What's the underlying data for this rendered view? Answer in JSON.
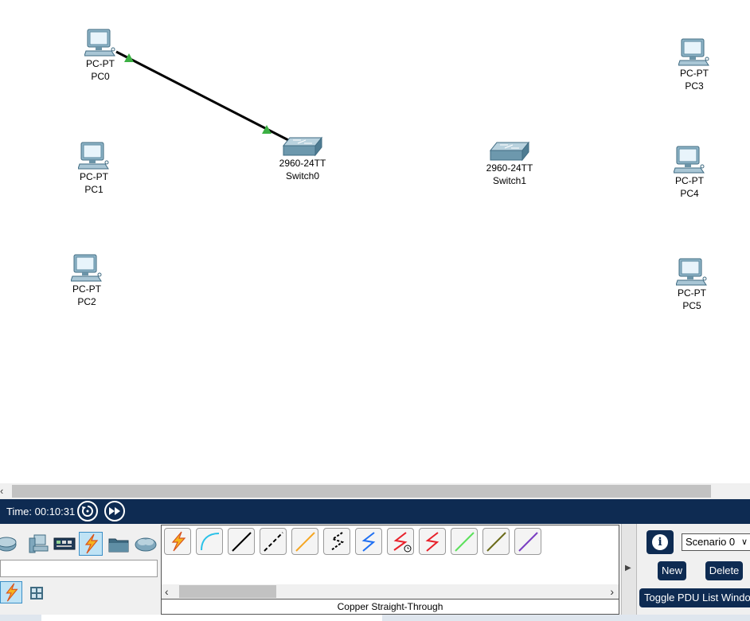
{
  "workspace": {
    "devices": [
      {
        "id": "pc0",
        "model": "PC-PT",
        "name": "PC0"
      },
      {
        "id": "pc1",
        "model": "PC-PT",
        "name": "PC1"
      },
      {
        "id": "pc2",
        "model": "PC-PT",
        "name": "PC2"
      },
      {
        "id": "switch0",
        "model": "2960-24TT",
        "name": "Switch0"
      },
      {
        "id": "switch1",
        "model": "2960-24TT",
        "name": "Switch1"
      },
      {
        "id": "pc3",
        "model": "PC-PT",
        "name": "PC3"
      },
      {
        "id": "pc4",
        "model": "PC-PT",
        "name": "PC4"
      },
      {
        "id": "pc5",
        "model": "PC-PT",
        "name": "PC5"
      }
    ],
    "link_colors": {
      "line": "#000000",
      "port_up": "#3cb043"
    }
  },
  "timebar": {
    "time_label": "Time: 00:10:31"
  },
  "device_categories": [
    "network-devices-icon",
    "end-devices-icon",
    "components-icon",
    "connections-icon",
    "miscellaneous-icon",
    "multiuser-icon"
  ],
  "cables": {
    "items": [
      "automatic-connection-icon",
      "console-cable-icon",
      "copper-straight-through-icon",
      "copper-cross-over-icon",
      "fiber-icon",
      "phone-cable-icon",
      "coaxial-cable-icon",
      "serial-dce-icon",
      "serial-dte-icon",
      "octal-cable-icon",
      "iot-custom-cable-icon",
      "usb-cable-icon"
    ],
    "selected_name": "Copper Straight-Through"
  },
  "pdu": {
    "scenario": "Scenario 0",
    "new_label": "New",
    "delete_label": "Delete",
    "toggle_label": "Toggle PDU List Window"
  },
  "colors": {
    "toolbar_navy": "#0e2b52",
    "selected_bg": "#bfe3f5"
  }
}
